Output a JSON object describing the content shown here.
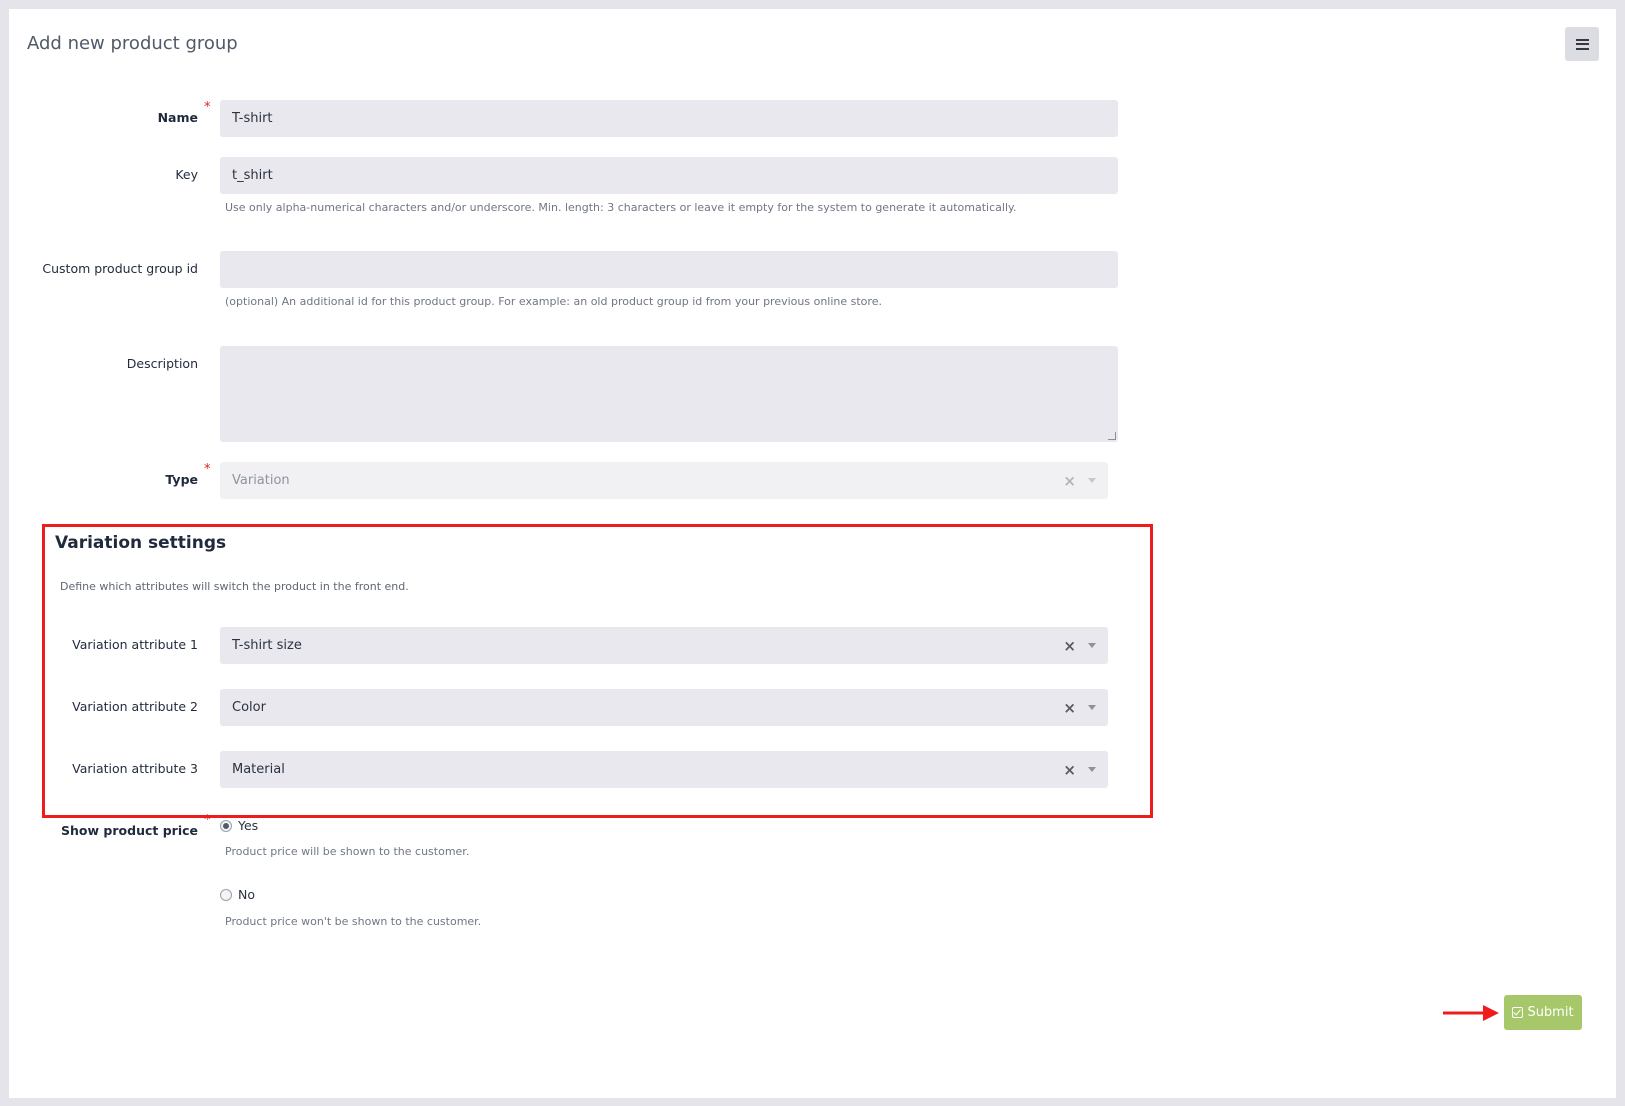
{
  "page": {
    "title": "Add new product group"
  },
  "form": {
    "name": {
      "label": "Name",
      "value": "T-shirt"
    },
    "key": {
      "label": "Key",
      "value": "t_shirt",
      "help": "Use only alpha-numerical characters and/or underscore. Min. length: 3 characters or leave it empty for the system to generate it automatically."
    },
    "custom_id": {
      "label": "Custom product group id",
      "value": "",
      "help": "(optional) An additional id for this product group. For example: an old product group id from your previous online store."
    },
    "description": {
      "label": "Description",
      "value": ""
    },
    "type": {
      "label": "Type",
      "value": "Variation"
    },
    "required_mark": "*"
  },
  "variation": {
    "title": "Variation settings",
    "description": "Define which attributes will switch the product in the front end.",
    "attributes": [
      {
        "label": "Variation attribute 1",
        "value": "T-shirt size"
      },
      {
        "label": "Variation attribute 2",
        "value": "Color"
      },
      {
        "label": "Variation attribute 3",
        "value": "Material"
      }
    ],
    "clear_glyph": "×"
  },
  "show_price": {
    "label": "Show product price",
    "options": [
      {
        "label": "Yes",
        "help": "Product price will be shown to the customer.",
        "checked": true
      },
      {
        "label": "No",
        "help": "Product price won't be shown to the customer.",
        "checked": false
      }
    ]
  },
  "actions": {
    "submit_label": "Submit"
  },
  "colors": {
    "accent_green": "#a6c86a",
    "highlight_red": "#ee1c1c",
    "field_bg": "#e8e8ee"
  },
  "icons": [
    "menu-icon",
    "check-square-icon",
    "clear-icon",
    "caret-down-icon",
    "arrow-right-icon"
  ]
}
